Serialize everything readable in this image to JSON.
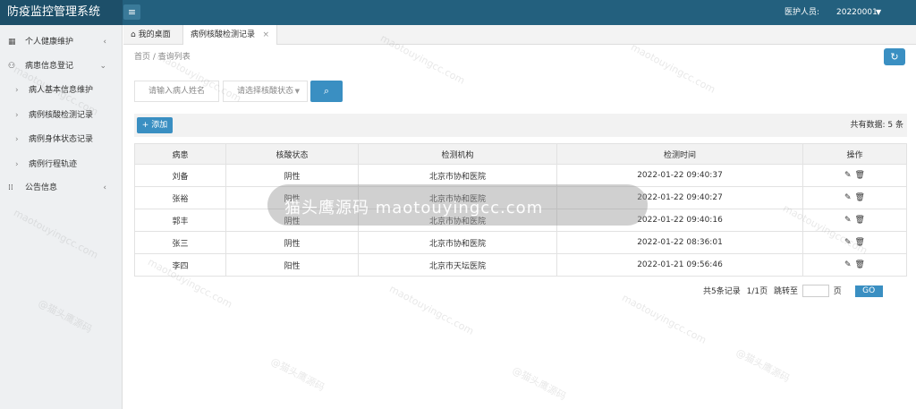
{
  "app": {
    "title": "防疫监控管理系统",
    "menu_icon": "hamburger-icon",
    "user_label": "医护人员:",
    "user_id": "20220001"
  },
  "sidebar": {
    "items": [
      {
        "label": "个人健康维护",
        "icon": "calendar-icon",
        "arrow": "‹"
      },
      {
        "label": "病患信息登记",
        "icon": "person-icon",
        "arrow": "⌄"
      },
      {
        "label": "病人基本信息维护",
        "icon": "chevron-right-icon"
      },
      {
        "label": "病例核酸检测记录",
        "icon": "chevron-right-icon"
      },
      {
        "label": "病例身体状态记录",
        "icon": "chevron-right-icon"
      },
      {
        "label": "病例行程轨迹",
        "icon": "chevron-right-icon"
      },
      {
        "label": "公告信息",
        "icon": "grid-icon",
        "arrow": "‹"
      }
    ]
  },
  "tabs": [
    {
      "label": "我的桌面",
      "icon": "home-icon"
    },
    {
      "label": "病例核酸检测记录",
      "close": "×"
    }
  ],
  "breadcrumb": "首页 / 查询列表",
  "search": {
    "name_placeholder": "请输入病人姓名",
    "status_placeholder": "请选择核酸状态"
  },
  "toolbar": {
    "add_label": "添加",
    "total_label": "共有数据: 5 条"
  },
  "table": {
    "headers": [
      "病患",
      "核酸状态",
      "检测机构",
      "检测时间",
      "操作"
    ],
    "rows": [
      {
        "patient": "刘备",
        "status": "阴性",
        "org": "北京市协和医院",
        "time": "2022-01-22 09:40:37"
      },
      {
        "patient": "张裕",
        "status": "阳性",
        "org": "北京市协和医院",
        "time": "2022-01-22 09:40:27"
      },
      {
        "patient": "郭丰",
        "status": "阴性",
        "org": "北京市协和医院",
        "time": "2022-01-22 09:40:16"
      },
      {
        "patient": "张三",
        "status": "阴性",
        "org": "北京市协和医院",
        "time": "2022-01-22 08:36:01"
      },
      {
        "patient": "李四",
        "status": "阳性",
        "org": "北京市天坛医院",
        "time": "2022-01-21 09:56:46"
      }
    ]
  },
  "pager": {
    "total": "共5条记录",
    "pages": "1/1页",
    "jump": "跳转至",
    "page_unit": "页",
    "go": "GO"
  },
  "watermark": {
    "pill_text": "猫头鹰源码 maotouyingcc.com",
    "text": "maotouyingcc.com",
    "brand": "@猫头鹰源码"
  }
}
